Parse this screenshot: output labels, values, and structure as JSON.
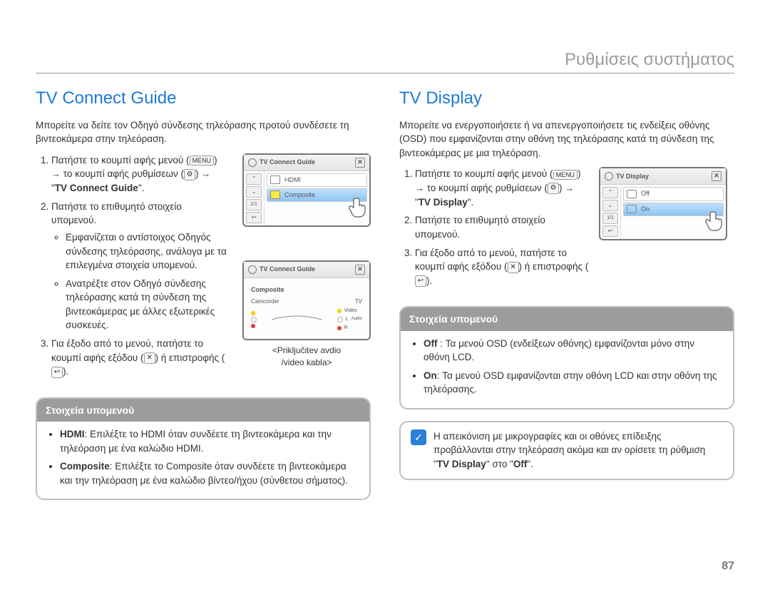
{
  "header": {
    "title": "Ρυθμίσεις συστήματος"
  },
  "left": {
    "heading": "TV Connect Guide",
    "intro": "Μπορείτε να δείτε τον Οδηγό σύνδεσης τηλεόρασης προτού συνδέσετε τη βιντεοκάμερα στην τηλεόραση.",
    "step1_a": "Πατήστε το κουμπί αφής μενού (",
    "step1_menu": "MENU",
    "step1_b": ") ",
    "step1_arrow": "→",
    "step1_c": " το κουμπί αφής ρυθμίσεων (",
    "step1_gear": "⚙",
    "step1_d": ") ",
    "step1_e": " \"",
    "step1_bold": "TV Connect Guide",
    "step1_f": "\".",
    "step2": "Πατήστε το επιθυμητό στοιχείο υπομενού.",
    "step2_b1": "Εμφανίζεται ο αντίστοιχος Οδηγός σύνδεσης τηλεόρασης, ανάλογα με τα επιλεγμένα στοιχεία υπομενού.",
    "step2_b2": "Ανατρέξτε στον Οδηγό σύνδεσης τηλεόρασης κατά τη σύνδεση της βιντεοκάμερας με άλλες εξωτερικές συσκευές.",
    "step3_a": "Για έξοδο από το μενού, πατήστε το κουμπί αφής εξόδου (",
    "step3_x": "✕",
    "step3_b": ") ή επιστροφής (",
    "step3_back": "↩",
    "step3_c": ").",
    "submenu_title": "Στοιχεία υπομενού",
    "sm1_bold": "HDMI",
    "sm1_text": ": Επιλέξτε το HDMI όταν συνδέετε τη βιντεοκάμερα και την τηλεόραση με ένα καλώδιο HDMI.",
    "sm2_bold": "Composite",
    "sm2_text": ": Επιλέξτε το Composite όταν συνδέετε τη βιντεοκάμερα και την τηλεόραση με ένα καλώδιο βίντεο/ήχου (σύνθετου σήματος).",
    "figure1": {
      "title": "TV Connect Guide",
      "row1": "HDMI",
      "row2": "Composite",
      "page": "1/1"
    },
    "figure2": {
      "title": "TV Connect Guide",
      "heading": "Composite",
      "camcorder": "Camcorder",
      "tv": "TV",
      "video": "Video",
      "audio": "Audio",
      "l": "L",
      "r": "R",
      "caption1": "<Priključitev avdio",
      "caption2": "/video kabla>"
    }
  },
  "right": {
    "heading": "TV Display",
    "intro": "Μπορείτε να ενεργοποιήσετε ή να απενεργοποιήσετε τις ενδείξεις οθόνης (OSD) που εμφανίζονται στην οθόνη της τηλεόρασης κατά τη σύνδεση της βιντεοκάμερας με μια τηλεόραση.",
    "step1_a": "Πατήστε το κουμπί αφής μενού (",
    "step1_menu": "MENU",
    "step1_b": ") ",
    "step1_arrow": "→",
    "step1_c": " το κουμπί αφής ρυθμίσεων (",
    "step1_gear": "⚙",
    "step1_d": ") ",
    "step1_e": " \"",
    "step1_bold": "TV Display",
    "step1_f": "\".",
    "step2": "Πατήστε το επιθυμητό στοιχείο υπομενού.",
    "step3_a": "Για έξοδο από το μενού, πατήστε το κουμπί αφής εξόδου (",
    "step3_x": "✕",
    "step3_b": ") ή επιστροφής (",
    "step3_back": "↩",
    "step3_c": ").",
    "submenu_title": "Στοιχεία υπομενού",
    "sm1_bold": "Off ",
    "sm1_text": ": Τα μενού OSD (ενδείξεων οθόνης) εμφανίζονται μόνο στην οθόνη LCD.",
    "sm2_bold": "On",
    "sm2_text": ": Τα μενού OSD εμφανίζονται στην οθόνη LCD και στην οθόνη της τηλεόρασης.",
    "note_a": "Η απεικόνιση με μικρογραφίες και οι οθόνες επίδειξης προβάλλονται στην τηλεόραση ακόμα και αν ορίσετε τη ρύθμιση \"",
    "note_bold1": "TV Display",
    "note_b": "\" στο \"",
    "note_bold2": "Off",
    "note_c": "\".",
    "figure": {
      "title": "TV Display",
      "row1": "Off",
      "row2": "On",
      "page": "1/1"
    }
  },
  "page_number": "87"
}
